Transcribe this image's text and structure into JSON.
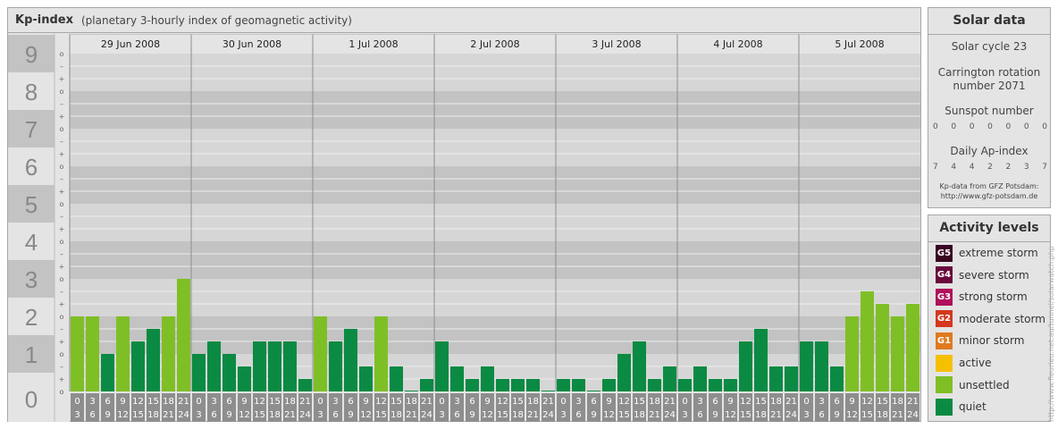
{
  "header": {
    "title": "Kp-index",
    "subtitle": "(planetary 3-hourly index of geomagnetic activity)"
  },
  "chart_data": {
    "type": "bar",
    "y_levels": [
      "0",
      "1",
      "2",
      "3",
      "4",
      "5",
      "6",
      "7",
      "8",
      "9"
    ],
    "sub_ticks": [
      "o",
      "–",
      "+"
    ],
    "ylim": [
      0,
      9
    ],
    "days": [
      "29 Jun 2008",
      "30 Jun 2008",
      "1 Jul 2008",
      "2 Jul 2008",
      "3 Jul 2008",
      "4 Jul 2008",
      "5 Jul 2008"
    ],
    "interval_start": [
      "0",
      "3",
      "6",
      "9",
      "12",
      "15",
      "18",
      "21"
    ],
    "interval_end": [
      "3",
      "6",
      "9",
      "12",
      "15",
      "18",
      "21",
      "24"
    ],
    "values": [
      [
        2.0,
        2.0,
        1.0,
        2.0,
        1.333,
        1.667,
        2.0,
        3.0
      ],
      [
        1.0,
        1.333,
        1.0,
        0.667,
        1.333,
        1.333,
        1.333,
        0.333
      ],
      [
        2.0,
        1.333,
        1.667,
        0.667,
        2.0,
        0.667,
        0.0,
        0.333
      ],
      [
        1.333,
        0.667,
        0.333,
        0.667,
        0.333,
        0.333,
        0.333,
        0.0
      ],
      [
        0.333,
        0.333,
        0.0,
        0.333,
        1.0,
        1.333,
        0.333,
        0.667
      ],
      [
        0.333,
        0.667,
        0.333,
        0.333,
        1.333,
        1.667,
        0.667,
        0.667
      ],
      [
        1.333,
        1.333,
        0.667,
        2.0,
        2.667,
        2.333,
        2.0,
        2.333
      ]
    ],
    "colors": {
      "quiet": "#0b8a43",
      "unsettled": "#7fbf26",
      "active": "#f5c000",
      "G1": "#e07a1e",
      "G2": "#d4381e",
      "G3": "#b0105a",
      "G4": "#6a0a3c",
      "G5": "#3a0420"
    }
  },
  "solar": {
    "title": "Solar data",
    "cycle": "Solar cycle 23",
    "carrington_line1": "Carrington rotation",
    "carrington_line2": "number 2071",
    "sunspot_label": "Sunspot number",
    "sunspot": [
      "0",
      "0",
      "0",
      "0",
      "0",
      "0",
      "0"
    ],
    "ap_label": "Daily Ap-index",
    "ap": [
      "7",
      "4",
      "4",
      "2",
      "2",
      "3",
      "7"
    ],
    "source_line1": "Kp-data from GFZ Potsdam:",
    "source_line2": "http://www.gfz-potsdam.de"
  },
  "activity": {
    "title": "Activity levels",
    "items": [
      {
        "code": "G5",
        "label": "extreme storm",
        "color": "#3a0420"
      },
      {
        "code": "G4",
        "label": "severe storm",
        "color": "#6a0a3c"
      },
      {
        "code": "G3",
        "label": "strong storm",
        "color": "#b0105a"
      },
      {
        "code": "G2",
        "label": "moderate storm",
        "color": "#d4381e"
      },
      {
        "code": "G1",
        "label": "minor storm",
        "color": "#e07a1e"
      },
      {
        "code": "",
        "label": "active",
        "color": "#f5c000"
      },
      {
        "code": "",
        "label": "unsettled",
        "color": "#7fbf26"
      },
      {
        "code": "",
        "label": "quiet",
        "color": "#0b8a43"
      }
    ]
  },
  "watermark": "http://www.fleurieu.net.au/tunnel/solarwatch.php"
}
